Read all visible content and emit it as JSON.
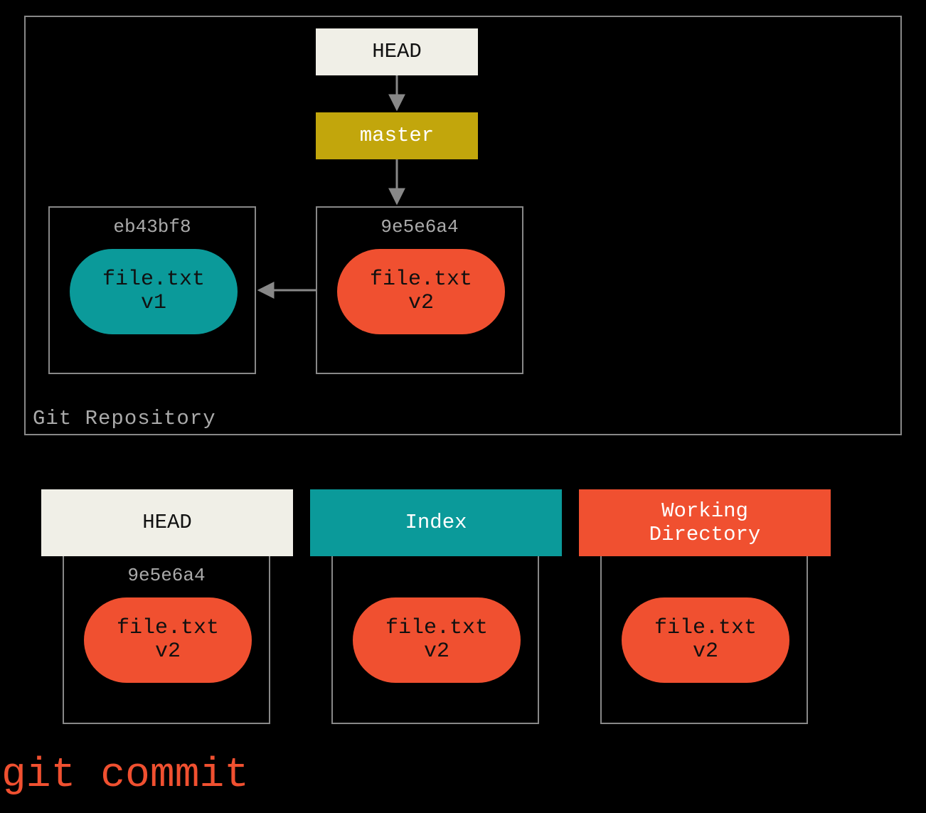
{
  "repo": {
    "label": "Git Repository",
    "head": {
      "label": "HEAD"
    },
    "branch": {
      "label": "master"
    },
    "commits": [
      {
        "hash": "eb43bf8",
        "file": "file.txt",
        "version": "v1",
        "color": "teal"
      },
      {
        "hash": "9e5e6a4",
        "file": "file.txt",
        "version": "v2",
        "color": "orange"
      }
    ]
  },
  "trees": {
    "head": {
      "title": "HEAD",
      "hash": "9e5e6a4",
      "file": "file.txt",
      "version": "v2"
    },
    "index": {
      "title": "Index",
      "file": "file.txt",
      "version": "v2"
    },
    "wd": {
      "title": "Working\nDirectory",
      "file": "file.txt",
      "version": "v2"
    }
  },
  "command": "git commit"
}
